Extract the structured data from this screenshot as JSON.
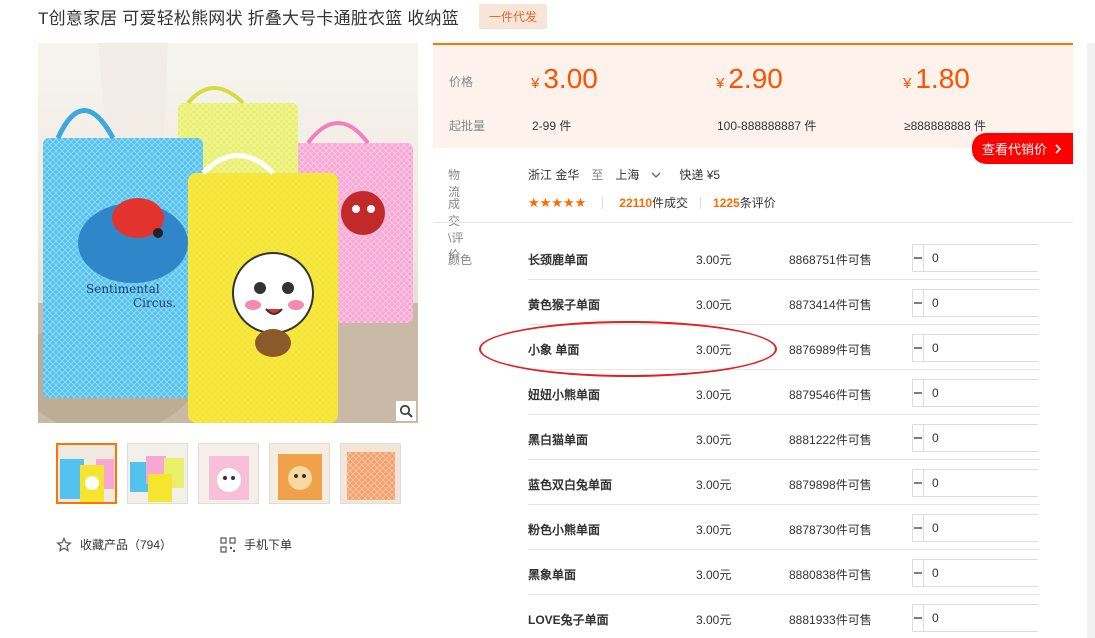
{
  "product": {
    "title": "T创意家居 可爱轻松熊网状 折叠大号卡通脏衣篮 收纳篮",
    "badge": "一件代发"
  },
  "gallery": {
    "zoom_icon": "magnifier-icon",
    "thumbnails": [
      {
        "alt": "thumbnail-1"
      },
      {
        "alt": "thumbnail-2"
      },
      {
        "alt": "thumbnail-3"
      },
      {
        "alt": "thumbnail-4"
      },
      {
        "alt": "thumbnail-5"
      }
    ]
  },
  "actions": {
    "favorite_label": "收藏产品（794）",
    "mobile_order_label": "手机下单"
  },
  "pricing": {
    "price_label": "价格",
    "min_qty_label": "起批量",
    "currency": "¥",
    "tiers": [
      {
        "price": "3.00",
        "range": "2-99 件"
      },
      {
        "price": "2.90",
        "range": "100-888888887 件"
      },
      {
        "price": "1.80",
        "range": "≥888888888 件"
      }
    ],
    "agent_price_button": "查看代销价"
  },
  "logistics": {
    "label": "物流",
    "from": "浙江 金华",
    "to_word": "至",
    "destination": "上海",
    "shipping": "快递 ¥5"
  },
  "reviews": {
    "label": "成交\\评价",
    "stars": "★★★★★",
    "deals_count": "22110",
    "deals_suffix": "件成交",
    "reviews_count": "1225",
    "reviews_suffix": "条评价"
  },
  "sku": {
    "color_label": "颜色",
    "rows": [
      {
        "name": "长颈鹿单面",
        "price": "3.00元",
        "stock": "8868751件可售",
        "qty": "0"
      },
      {
        "name": "黄色猴子单面",
        "price": "3.00元",
        "stock": "8873414件可售",
        "qty": "0"
      },
      {
        "name": "小象 单面",
        "price": "3.00元",
        "stock": "8876989件可售",
        "qty": "0"
      },
      {
        "name": "妞妞小熊单面",
        "price": "3.00元",
        "stock": "8879546件可售",
        "qty": "0"
      },
      {
        "name": "黑白猫单面",
        "price": "3.00元",
        "stock": "8881222件可售",
        "qty": "0"
      },
      {
        "name": "蓝色双白兔单面",
        "price": "3.00元",
        "stock": "8879898件可售",
        "qty": "0"
      },
      {
        "name": "粉色小熊单面",
        "price": "3.00元",
        "stock": "8878730件可售",
        "qty": "0"
      },
      {
        "name": "黑象单面",
        "price": "3.00元",
        "stock": "8880838件可售",
        "qty": "0"
      },
      {
        "name": "LOVE兔子单面",
        "price": "3.00元",
        "stock": "8881933件可售",
        "qty": "0"
      }
    ]
  },
  "colors": {
    "accent": "#ff7300",
    "price": "#ff5000",
    "agent_button": "#ff0000",
    "annotation_ellipse": "#e02020"
  }
}
